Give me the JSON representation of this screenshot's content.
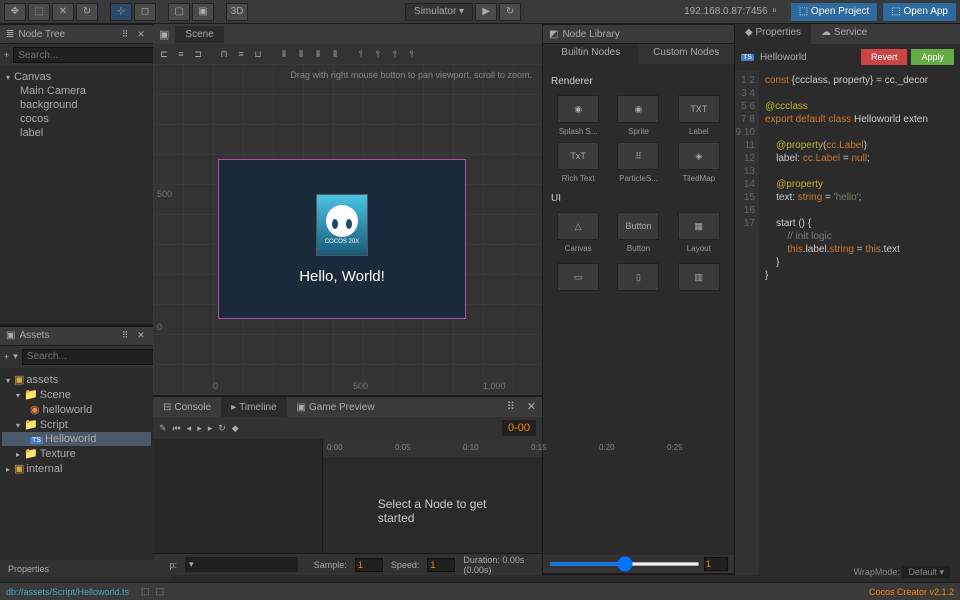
{
  "toolbar": {
    "btn_3d": "3D",
    "simulator": "Simulator ▾",
    "ip": "192.168.0.87:7456  ⚬",
    "open_project": "⬚ Open Project",
    "open_app": "⬚ Open App"
  },
  "node_tree": {
    "title": "Node Tree",
    "search_placeholder": "Search...",
    "items": [
      "Canvas",
      "Main Camera",
      "background",
      "cocos",
      "label"
    ]
  },
  "assets": {
    "title": "Assets",
    "search_placeholder": "Search...",
    "items": [
      "assets",
      "Scene",
      "helloworld",
      "Script",
      "Helloworld",
      "Texture",
      "internal"
    ]
  },
  "scene": {
    "tab": "Scene",
    "hint": "Drag with right mouse button to pan viewport, scroll to zoom.",
    "hello_text": "Hello, World!",
    "logo_text": "COCOS 20X",
    "rulers": {
      "r500a": "500",
      "r0": "0",
      "r500b": "500",
      "r1000": "1,000",
      "v0": "0"
    }
  },
  "node_library": {
    "title": "Node Library",
    "tab_builtin": "Builtin Nodes",
    "tab_custom": "Custom Nodes",
    "sec_renderer": "Renderer",
    "sec_ui": "UI",
    "items_renderer": [
      "Splash S...",
      "Sprite",
      "Label",
      "Rich Text",
      "ParticleS...",
      "TiledMap"
    ],
    "items_ui": [
      "Canvas",
      "Button",
      "Layout"
    ],
    "icons_renderer": [
      "◉",
      "◉",
      "TXT",
      "TxT",
      "⠿",
      "◈"
    ],
    "icons_ui": [
      "△",
      "Button",
      "▦"
    ],
    "slider_val": "1"
  },
  "properties": {
    "tab_props": "Properties",
    "tab_service": "Service",
    "script_name": "Helloworld",
    "revert": "Revert",
    "apply": "Apply"
  },
  "code": {
    "lines": [
      "const {ccclass, property} = cc._decor",
      "",
      "@ccclass",
      "export default class Helloworld exten",
      "",
      "    @property(cc.Label)",
      "    label: cc.Label = null;",
      "",
      "    @property",
      "    text: string = 'hello';",
      "",
      "    start () {",
      "        // init logic",
      "        this.label.string = this.text",
      "    }",
      "}",
      ""
    ]
  },
  "bottom": {
    "tab_console": "Console",
    "tab_timeline": "Timeline",
    "tab_preview": "Game Preview",
    "time_pos": "0-00",
    "ticks": [
      "0:00",
      "0:05",
      "0:10",
      "0:15",
      "0:20",
      "0:25"
    ],
    "msg": "Select a Node to get started",
    "properties": "Properties",
    "wrap": "WrapMode:",
    "wrap_val": "Default",
    "clip": "Clip:",
    "sample": "Sample:",
    "sample_val": "1",
    "speed": "Speed:",
    "speed_val": "1",
    "duration": "Duration: 0.00s (0.00s)"
  },
  "status": {
    "path": "db://assets/Script/Helloworld.ts",
    "version": "Cocos Creator v2.1.2"
  }
}
